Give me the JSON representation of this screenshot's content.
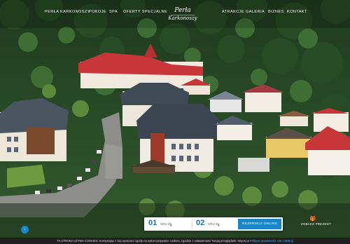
{
  "nav": {
    "left": [
      "PERŁA KARKONOSZY",
      "POKOJE",
      "SPA",
      "OFERTY SPECJALNE"
    ],
    "right": [
      "ATRAKCJE",
      "GALERIA",
      "BIZNES",
      "KONTAKT"
    ]
  },
  "logo": {
    "line1": "Perła",
    "line2": "Karkonoszy"
  },
  "booking": {
    "checkin": {
      "day": "01",
      "month": "GRU 25"
    },
    "checkout": {
      "day": "02",
      "month": "GRU 25"
    },
    "button": "REZERWUJ ONLINE"
  },
  "see_more": {
    "label": "ZOBACZ PREZENT"
  },
  "cookie": {
    "text": "TA STRONA UŻYWA COOKIES. Korzystając z niej wyrażasz zgodę na wykorzystywanie cookies, zgodnie z ustawieniami Twojej przeglądarki. Więcej w",
    "link": "Polityce prywatności",
    "close": "OK, zamknij"
  },
  "colors": {
    "accent": "#1a86c8",
    "cookie_bar": "#1f1f1f",
    "roof_red": "#c8363a",
    "forest": "#2f5a2b"
  },
  "icons": {
    "scroll": "arrow-down-icon",
    "gift": "gift-icon",
    "chevron": "chevron-down-icon"
  }
}
